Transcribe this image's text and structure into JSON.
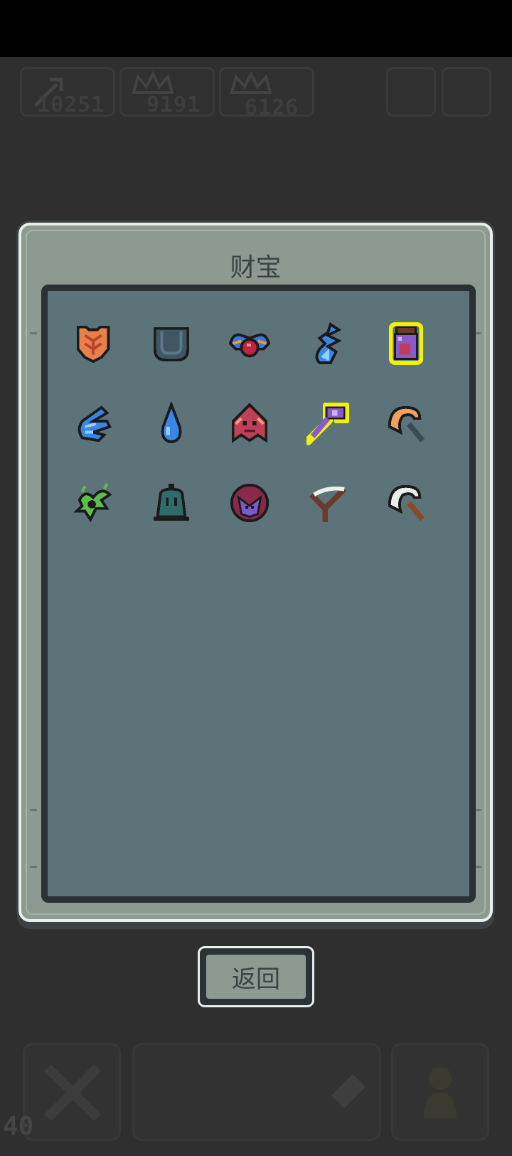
{
  "hud": {
    "resource_1": "10251",
    "resource_2": "9191",
    "resource_3": "6126"
  },
  "modal": {
    "title": "财宝",
    "items": [
      {
        "icon": "orange-shield-icon"
      },
      {
        "icon": "dark-pocket-icon"
      },
      {
        "icon": "red-gem-amulet-icon"
      },
      {
        "icon": "blue-flame-icon"
      },
      {
        "icon": "potion-jar-icon",
        "highlighted": true
      },
      {
        "icon": "blue-wing-icon"
      },
      {
        "icon": "water-drop-icon"
      },
      {
        "icon": "demon-mask-icon"
      },
      {
        "icon": "purple-key-icon",
        "highlighted": true
      },
      {
        "icon": "orange-sickle-icon"
      },
      {
        "icon": "green-sprout-icon"
      },
      {
        "icon": "teal-bell-icon"
      },
      {
        "icon": "purple-orb-icon"
      },
      {
        "icon": "slingshot-icon"
      },
      {
        "icon": "white-sickle-icon"
      }
    ]
  },
  "back_button": {
    "label": "返回"
  },
  "footer": {
    "level": "40"
  },
  "colors": {
    "background": "#2f2f2f",
    "modal_frame": "#8c9a92",
    "grid_panel": "#5d737a",
    "highlight": "#f2f200"
  }
}
